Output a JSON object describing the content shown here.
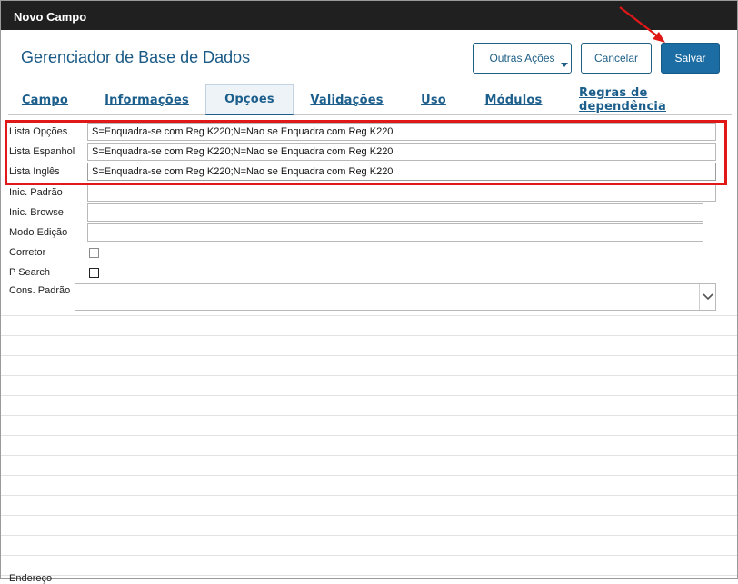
{
  "window": {
    "title": "Novo Campo"
  },
  "header": {
    "heading": "Gerenciador de Base de Dados"
  },
  "buttons": {
    "other_actions": "Outras Ações",
    "cancel": "Cancelar",
    "save": "Salvar"
  },
  "tabs": [
    {
      "label": "Campo",
      "active": false
    },
    {
      "label": "Informações",
      "active": false
    },
    {
      "label": "Opções",
      "active": true
    },
    {
      "label": "Validações",
      "active": false
    },
    {
      "label": "Uso",
      "active": false
    },
    {
      "label": "Módulos",
      "active": false
    },
    {
      "label": "Regras de dependência",
      "active": false
    }
  ],
  "fields": {
    "lista_opcoes": {
      "label": "Lista Opções",
      "value": "S=Enquadra-se com Reg K220;N=Nao se Enquadra com Reg K220"
    },
    "lista_espanhol": {
      "label": "Lista Espanhol",
      "value": "S=Enquadra-se com Reg K220;N=Nao se Enquadra com Reg K220"
    },
    "lista_ingles": {
      "label": "Lista Inglês",
      "value": "S=Enquadra-se com Reg K220;N=Nao se Enquadra com Reg K220"
    },
    "inic_padrao": {
      "label": "Inic. Padrão",
      "value": ""
    },
    "inic_browse": {
      "label": "Inic. Browse",
      "value": ""
    },
    "modo_edicao": {
      "label": "Modo Edição",
      "value": ""
    },
    "corretor": {
      "label": "Corretor",
      "checked": false
    },
    "p_search": {
      "label": "P Search",
      "checked": false
    },
    "cons_padrao": {
      "label": "Cons. Padrão",
      "value": ""
    }
  },
  "footer": {
    "partial_label": "Endereço"
  },
  "colors": {
    "titlebar": "#202020",
    "accent": "#1c6da3",
    "highlight": "#e01818"
  }
}
